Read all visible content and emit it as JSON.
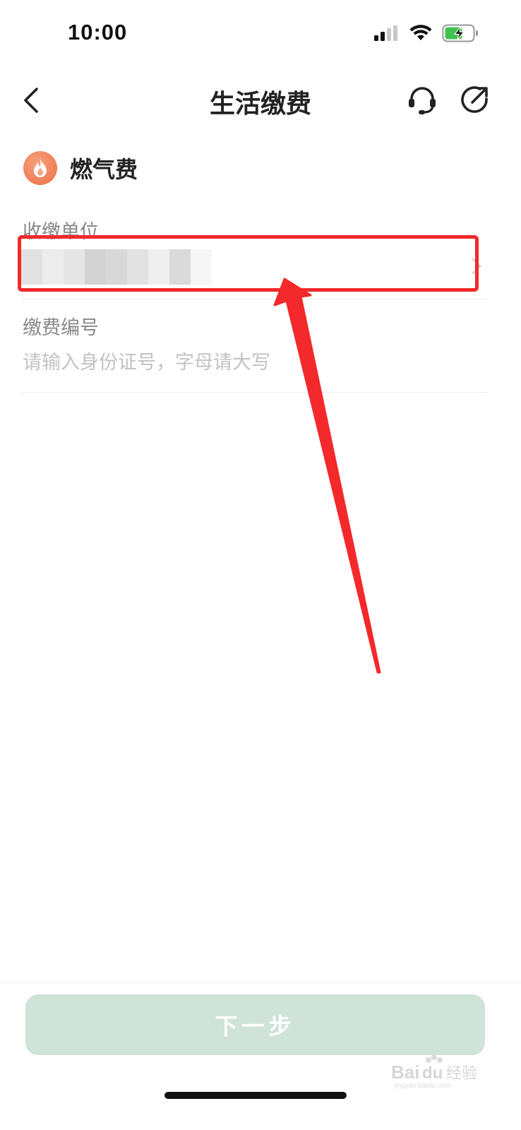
{
  "status_bar": {
    "time": "10:00"
  },
  "nav": {
    "title": "生活缴费"
  },
  "category": {
    "label": "燃气费"
  },
  "form": {
    "unit_label": "收缴单位",
    "unit_value_obscured": true,
    "number_label": "缴费编号",
    "number_placeholder": "请输入身份证号，字母请大写",
    "number_value": ""
  },
  "next_button": {
    "label": "下一步"
  },
  "watermark": {
    "text": "Baidu经验",
    "subtext": "jingyan.baidu.com"
  },
  "colors": {
    "accent_disabled": "#cfe3d9",
    "annotation_red": "#f3292b",
    "category_icon": "#ec7048",
    "battery_green": "#3fc24e"
  }
}
